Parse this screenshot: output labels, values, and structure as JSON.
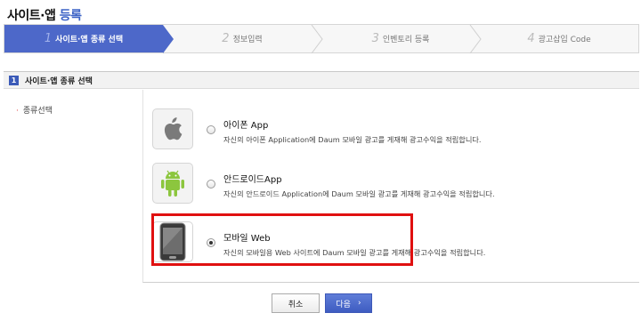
{
  "page": {
    "title_main": "사이트·앱",
    "title_accent": "등록"
  },
  "steps": [
    {
      "num": "1",
      "label": "사이트·앱 종류 선택"
    },
    {
      "num": "2",
      "label": "정보입력"
    },
    {
      "num": "3",
      "label": "인벤토리 등록"
    },
    {
      "num": "4",
      "label": "광고삽입 Code"
    }
  ],
  "section": {
    "number": "1",
    "title": "사이트·앱 종류 선택"
  },
  "side_label": "종류선택",
  "options": [
    {
      "title": "아이폰 App",
      "desc": "자신의 아이폰 Application에 Daum 모바일 광고를 게재해 광고수익을 적립합니다.",
      "icon": "apple-icon",
      "checked": false
    },
    {
      "title": "안드로이드App",
      "desc": "자신의 안드로이드 Application에 Daum 모바일 광고를 게재해 광고수익을 적립합니다.",
      "icon": "android-icon",
      "checked": false
    },
    {
      "title": "모바일 Web",
      "desc": "자신의 모바일용 Web 사이트에 Daum 모바일 광고를 게재해 광고수익을 적립합니다.",
      "icon": "mobile-phone-icon",
      "checked": true
    }
  ],
  "buttons": {
    "cancel": "취소",
    "next": "다음",
    "next_icon": "chevron-right-icon"
  },
  "colors": {
    "accent": "#4d68c9",
    "highlight": "#e01010",
    "android": "#8cc63e"
  }
}
